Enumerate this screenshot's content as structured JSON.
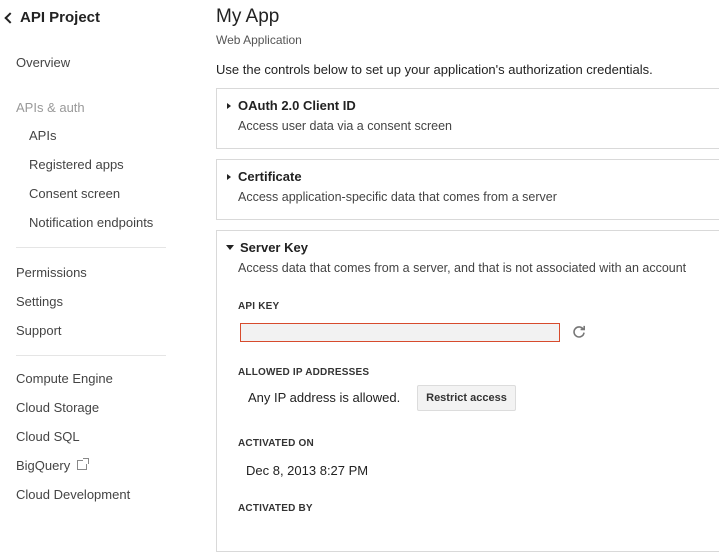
{
  "sidebar": {
    "back_label": "API Project",
    "overview": "Overview",
    "apis_section": "APIs & auth",
    "sub_items": [
      "APIs",
      "Registered apps",
      "Consent screen",
      "Notification endpoints"
    ],
    "items_group1": [
      "Permissions",
      "Settings",
      "Support"
    ],
    "items_group2": [
      "Compute Engine",
      "Cloud Storage",
      "Cloud SQL",
      "BigQuery",
      "Cloud Development"
    ]
  },
  "main": {
    "title": "My App",
    "subtitle": "Web Application",
    "intro": "Use the controls below to set up your application's authorization credentials.",
    "panels": [
      {
        "title": "OAuth 2.0 Client ID",
        "desc": "Access user data via a consent screen",
        "expanded": false
      },
      {
        "title": "Certificate",
        "desc": "Access application-specific data that comes from a server",
        "expanded": false
      },
      {
        "title": "Server Key",
        "desc": "Access data that comes from a server, and that is not associated with an account",
        "expanded": true
      }
    ],
    "server_key": {
      "api_key_label": "API KEY",
      "api_key_value": "",
      "allowed_ips_label": "ALLOWED IP ADDRESSES",
      "allowed_ips_value": "Any IP address is allowed.",
      "restrict_button": "Restrict access",
      "activated_on_label": "ACTIVATED ON",
      "activated_on_value": "Dec 8, 2013 8:27 PM",
      "activated_by_label": "ACTIVATED BY"
    }
  },
  "colors": {
    "input_border": "#d74b2d",
    "input_bg": "#f2f2f2",
    "panel_border": "#d9d9d9"
  }
}
